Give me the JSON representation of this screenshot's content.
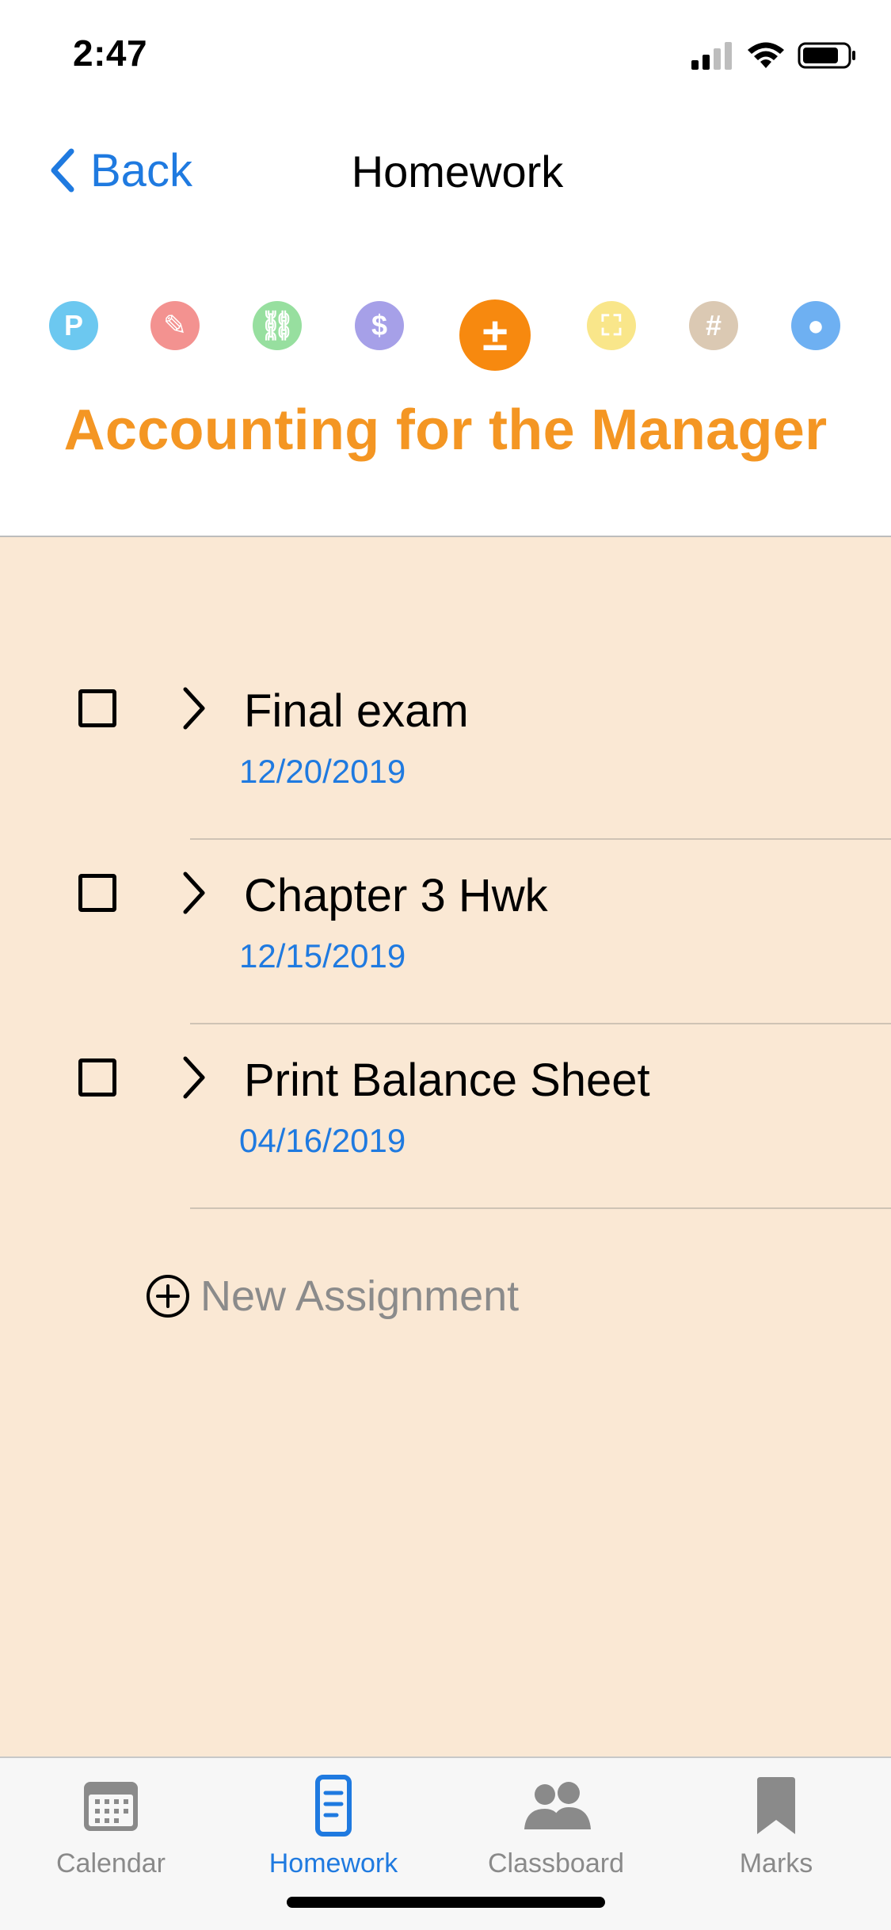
{
  "status_bar": {
    "time": "2:47"
  },
  "nav": {
    "back_label": "Back",
    "title": "Homework"
  },
  "color_options": [
    {
      "glyph": "P",
      "color": "#6cc8f0",
      "icon": "p-icon"
    },
    {
      "glyph": "✎",
      "color": "#f39290",
      "icon": "pencil-icon"
    },
    {
      "glyph": "⛓",
      "color": "#97df9f",
      "icon": "link-icon"
    },
    {
      "glyph": "$",
      "color": "#a6a0e8",
      "icon": "dollar-icon"
    },
    {
      "glyph": "±",
      "color": "#f7890f",
      "icon": "plus-minus-icon",
      "selected": true
    },
    {
      "glyph": "⛶",
      "color": "#f9e68a",
      "icon": "scan-icon"
    },
    {
      "glyph": "#",
      "color": "#dbc9b3",
      "icon": "hash-icon"
    },
    {
      "glyph": "●",
      "color": "#6eb0f2",
      "icon": "person-icon"
    }
  ],
  "course": {
    "title": "Accounting for the Manager",
    "color": "#f49623"
  },
  "assignments": [
    {
      "title": "Final exam",
      "date": "12/20/2019"
    },
    {
      "title": "Chapter 3 Hwk",
      "date": "12/15/2019"
    },
    {
      "title": "Print Balance Sheet",
      "date": "04/16/2019"
    }
  ],
  "new_assignment": {
    "label": "New Assignment"
  },
  "tabs": [
    {
      "label": "Calendar",
      "icon": "calendar-icon"
    },
    {
      "label": "Homework",
      "icon": "homework-icon",
      "active": true
    },
    {
      "label": "Classboard",
      "icon": "classboard-icon"
    },
    {
      "label": "Marks",
      "icon": "bookmark-icon"
    }
  ],
  "colors": {
    "accent_blue": "#1f7ae0",
    "content_background": "#fae8d4",
    "course_orange": "#f49623"
  }
}
